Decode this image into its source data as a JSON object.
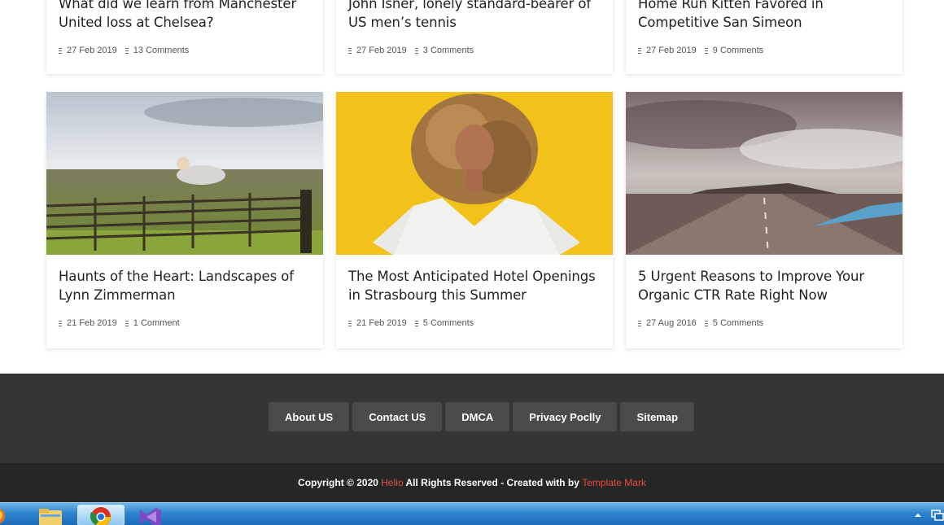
{
  "cards_top": [
    {
      "title_line1": "What did we learn from Manchester",
      "title_line2": "United loss at Chelsea?",
      "date": "27 Feb 2019",
      "comments": "13 Comments"
    },
    {
      "title_line1": "John Isner, lonely standard-bearer of",
      "title_line2": "US men’s tennis",
      "date": "27 Feb 2019",
      "comments": "3 Comments"
    },
    {
      "title_line1": "Home Run Kitten Favored in",
      "title_line2": "Competitive San Simeon",
      "date": "27 Feb 2019",
      "comments": "9 Comments"
    }
  ],
  "cards_bottom": [
    {
      "title_line1": "Haunts of the Heart: Landscapes of",
      "title_line2": "Lynn Zimmerman",
      "date": "21 Feb 2019",
      "comments": "1 Comment"
    },
    {
      "title_line1": "The Most Anticipated Hotel Openings",
      "title_line2": "in Strasbourg this Summer",
      "date": "21 Feb 2019",
      "comments": "5 Comments"
    },
    {
      "title_line1": "5 Urgent Reasons to Improve Your",
      "title_line2": "Organic CTR Rate Right Now",
      "date": "27 Aug 2016",
      "comments": "5 Comments"
    }
  ],
  "footer": {
    "links": [
      "About US",
      "Contact US",
      "DMCA",
      "Privacy Poclly",
      "Sitemap"
    ],
    "copyright_prefix": "Copyright © 2020",
    "brand": "Helio",
    "copyright_mid": "All Rights Reserved - Created with by",
    "template": "Template Mark"
  },
  "taskbar": {
    "apps": [
      "firefox-icon",
      "file-explorer-icon",
      "chrome-icon",
      "visual-studio-icon"
    ]
  },
  "colors": {
    "accent_red": "#e84c3d",
    "footer_bg": "#353535",
    "copyright_bg": "#262626",
    "link_button_bg": "#4b4b4b"
  }
}
